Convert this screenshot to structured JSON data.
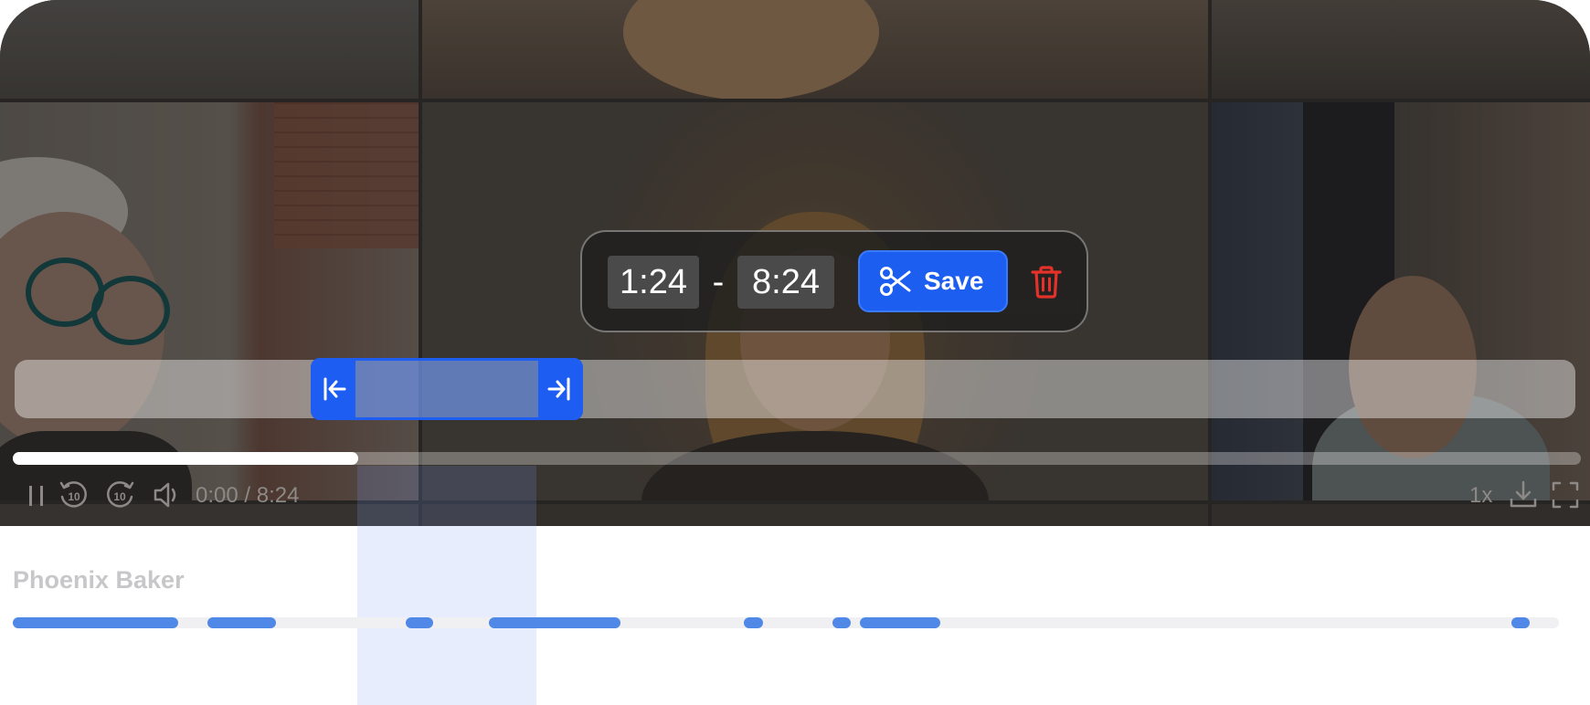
{
  "trim": {
    "start_time": "1:24",
    "separator": "-",
    "end_time": "8:24",
    "save_label": "Save",
    "selection_start_fraction": 0.205,
    "selection_end_fraction": 0.385
  },
  "player": {
    "current_time_display": "0:00 / 8:24",
    "progress_fraction": 0.22,
    "speed_label": "1x",
    "rewind_label": "10",
    "forward_label": "10"
  },
  "speaker": {
    "name": "Phoenix Baker",
    "segments": [
      {
        "start": 0.0,
        "end": 0.107
      },
      {
        "start": 0.126,
        "end": 0.17
      },
      {
        "start": 0.254,
        "end": 0.272
      },
      {
        "start": 0.308,
        "end": 0.393
      },
      {
        "start": 0.473,
        "end": 0.485
      },
      {
        "start": 0.53,
        "end": 0.542
      },
      {
        "start": 0.548,
        "end": 0.6
      },
      {
        "start": 0.969,
        "end": 0.981
      }
    ]
  },
  "colors": {
    "accent": "#1c5ef0",
    "delete": "#e4322b",
    "segment": "#5088e8"
  },
  "icons": [
    "scissors-icon",
    "trash-icon",
    "arrow-to-left-bar-icon",
    "arrow-to-right-bar-icon",
    "pause-icon",
    "rewind-10-icon",
    "forward-10-icon",
    "volume-icon",
    "download-icon",
    "fullscreen-icon"
  ]
}
